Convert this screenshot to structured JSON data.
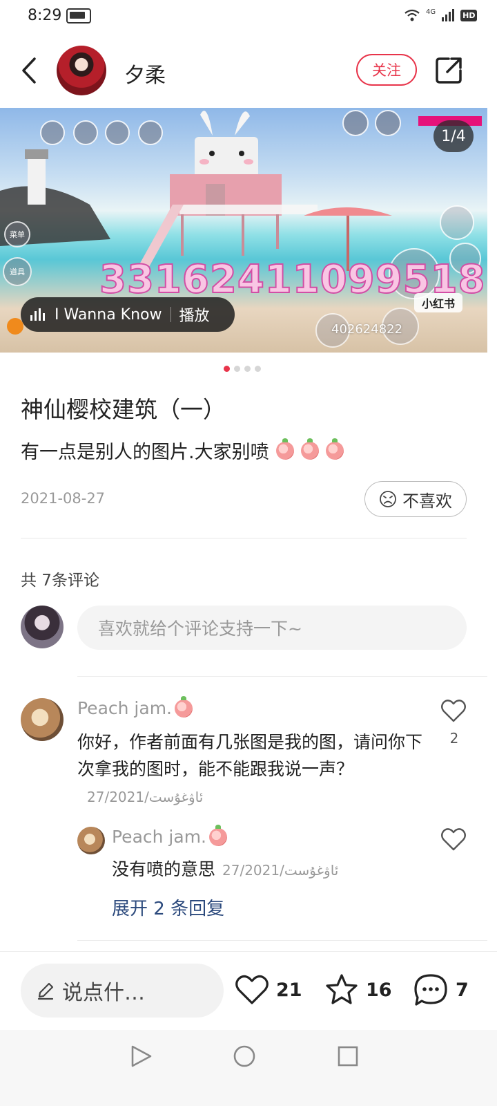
{
  "status_bar": {
    "time": "8:29",
    "network": "4G",
    "hd": "HD"
  },
  "header": {
    "author_name": "夕柔",
    "follow_label": "关注"
  },
  "carousel": {
    "page_indicator": "1/4",
    "current_page": 1,
    "total_pages": 4,
    "overlay_number": "33162411099518",
    "watermark": "小红书",
    "watermark_id": "402624822",
    "game_menu_label": "菜单",
    "game_prop_label": "道具",
    "music": {
      "title": "I Wanna Know",
      "play_label": "播放"
    }
  },
  "post": {
    "title": "神仙樱校建筑（一）",
    "body": "有一点是别人的图片.大家别喷",
    "date": "2021-08-27",
    "dislike_label": "不喜欢"
  },
  "comments": {
    "count_label": "共 7条评论",
    "input_placeholder": "喜欢就给个评论支持一下~",
    "items": [
      {
        "user": "Peach jam.",
        "text": "你好，作者前面有几张图是我的图，请问你下次拿我的图时，能不能跟我说一声？",
        "date": "ئاۋغۇست/27/2021",
        "likes": "2",
        "reply": {
          "user": "Peach jam.",
          "text": "没有喷的意思",
          "date": "27/2021/ئاۋغۇست"
        },
        "expand_label": "展开 2 条回复"
      }
    ]
  },
  "bottom_bar": {
    "input_label": "说点什…",
    "like_count": "21",
    "collect_count": "16",
    "comment_count": "7"
  },
  "colors": {
    "accent": "#e8344a",
    "link": "#2c4a7d"
  }
}
